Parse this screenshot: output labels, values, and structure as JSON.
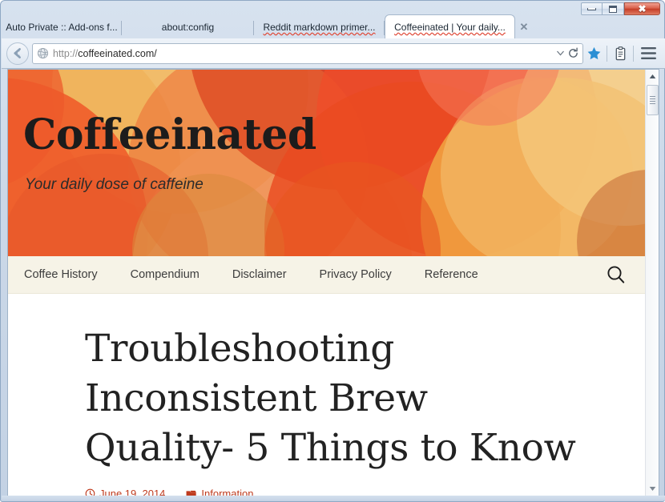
{
  "browser": {
    "window_controls": {
      "minimize_label": "–",
      "maximize_label": "□",
      "close_label": "✕"
    },
    "tabs": [
      {
        "title": "Auto Private :: Add-ons f...",
        "active": false,
        "misspelled": false
      },
      {
        "title": "about:config",
        "active": false,
        "misspelled": false
      },
      {
        "title": "Reddit markdown primer...",
        "active": false,
        "misspelled": true
      },
      {
        "title": "Coffeeinated | Your daily...",
        "active": true,
        "misspelled": true
      }
    ],
    "tab_close_label": "✕",
    "url": {
      "scheme": "http://",
      "host_path": "coffeeinated.com/",
      "full": "http://coffeeinated.com/"
    },
    "toolbar": {
      "back_icon": "back-arrow-icon",
      "favicon": "globe-favicon",
      "dropdown_icon": "chevron-down-icon",
      "reload_icon": "reload-icon",
      "bookmark_icon": "star-icon",
      "reader_icon": "reader-view-icon",
      "menu_icon": "hamburger-menu-icon",
      "bookmark_color": "#2b8fd4"
    },
    "scrollbar": {
      "up_label": "▲",
      "down_label": "▼"
    }
  },
  "site": {
    "title": "Coffeeinated",
    "tagline": "Your daily dose of caffeine",
    "nav": [
      {
        "label": "Coffee History"
      },
      {
        "label": "Compendium"
      },
      {
        "label": "Disclaimer"
      },
      {
        "label": "Privacy Policy"
      },
      {
        "label": "Reference"
      }
    ],
    "search_icon": "search-icon",
    "colors": {
      "nav_background": "#f6f3e7",
      "meta_accent": "#bf3b1e",
      "banner_base": "#f7f3e4"
    }
  },
  "article": {
    "title": "Troubleshooting Inconsistent Brew Quality- 5 Things to Know",
    "date": "June 19, 2014",
    "date_icon": "clock-icon",
    "category": "Information",
    "category_icon": "folder-icon"
  }
}
